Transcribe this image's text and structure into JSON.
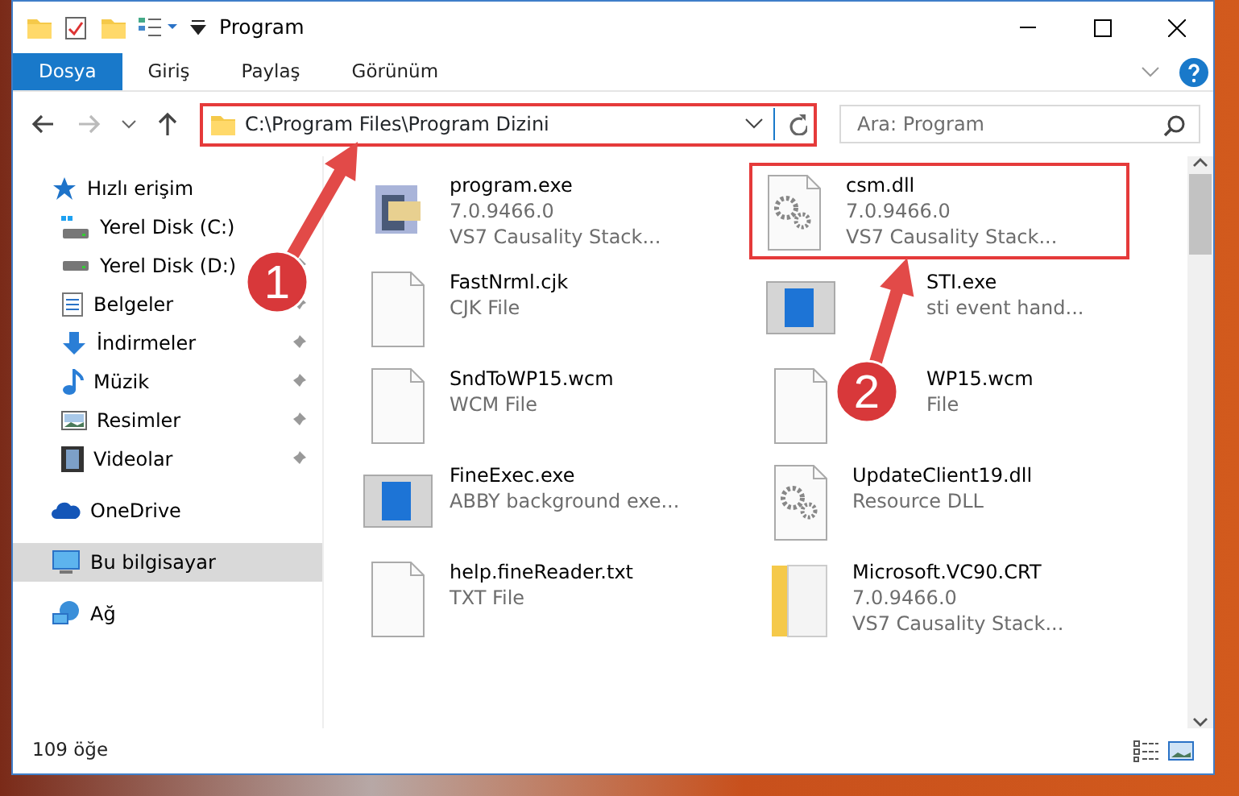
{
  "window": {
    "title": "Program"
  },
  "ribbon_tabs": [
    {
      "label": "Dosya",
      "selected": true
    },
    {
      "label": "Giriş",
      "selected": false
    },
    {
      "label": "Paylaş",
      "selected": false
    },
    {
      "label": "Görünüm",
      "selected": false
    }
  ],
  "address_bar": {
    "path": "C:\\Program Files\\Program Dizini"
  },
  "search": {
    "placeholder": "Ara: Program"
  },
  "sidebar": {
    "items": [
      {
        "label": "Hızlı erişim",
        "kind": "star",
        "selected": false,
        "children": [
          {
            "label": "Yerel Disk (C:)",
            "kind": "drive-c",
            "pinned": false
          },
          {
            "label": "Yerel Disk (D:)",
            "kind": "drive",
            "pinned": true
          },
          {
            "label": "Belgeler",
            "kind": "documents",
            "pinned": true
          },
          {
            "label": "İndirmeler",
            "kind": "downloads",
            "pinned": true
          },
          {
            "label": "Müzik",
            "kind": "music",
            "pinned": true
          },
          {
            "label": "Resimler",
            "kind": "pictures",
            "pinned": true
          },
          {
            "label": "Videolar",
            "kind": "videos",
            "pinned": true
          }
        ]
      },
      {
        "label": "OneDrive",
        "kind": "cloud",
        "selected": false
      },
      {
        "label": "Bu bilgisayar",
        "kind": "computer",
        "selected": true
      },
      {
        "label": "Ağ",
        "kind": "network",
        "selected": false
      }
    ]
  },
  "files": [
    {
      "name": "program.exe",
      "details": [
        "7.0.9466.0",
        "VS7 Causality Stack..."
      ],
      "kind": "app",
      "highlighted": false
    },
    {
      "name": "csm.dll",
      "details": [
        "7.0.9466.0",
        "VS7 Causality Stack..."
      ],
      "kind": "gears",
      "highlighted": true
    },
    {
      "name": "FastNrml.cjk",
      "details": [
        "CJK File"
      ],
      "kind": "blank",
      "highlighted": false
    },
    {
      "name": "STI.exe",
      "details": [
        "sti event hand..."
      ],
      "kind": "window",
      "highlighted": false,
      "covered": true
    },
    {
      "name": "SndToWP15.wcm",
      "details": [
        "WCM File"
      ],
      "kind": "blank",
      "highlighted": false
    },
    {
      "name": "WP15.wcm",
      "details": [
        "File"
      ],
      "kind": "blank",
      "highlighted": false,
      "covered": true
    },
    {
      "name": "FineExec.exe",
      "details": [
        "ABBY background exe..."
      ],
      "kind": "window",
      "highlighted": false
    },
    {
      "name": "UpdateClient19.dll",
      "details": [
        "Resource DLL"
      ],
      "kind": "gears",
      "highlighted": false
    },
    {
      "name": "help.fineReader.txt",
      "details": [
        "TXT File"
      ],
      "kind": "blank",
      "highlighted": false
    },
    {
      "name": "Microsoft.VC90.CRT",
      "details": [
        "7.0.9466.0",
        "VS7 Causality Stack..."
      ],
      "kind": "folder",
      "highlighted": false
    }
  ],
  "status_bar": {
    "count": "109 öğe"
  },
  "annotations": [
    {
      "label": "1"
    },
    {
      "label": "2"
    }
  ]
}
